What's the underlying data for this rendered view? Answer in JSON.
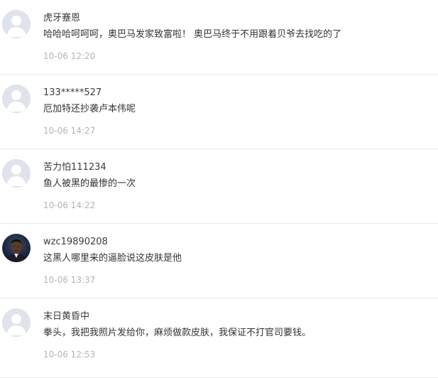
{
  "comments": [
    {
      "username": "虎牙蹇恩",
      "text": "哈哈哈呵呵呵，奥巴马发家致富啦！ 奥巴马终于不用跟着贝爷去找吃的了",
      "time": "10-06 12:20",
      "avatar": "default-avatar-icon"
    },
    {
      "username": "133*****527",
      "text": "厄加特还抄袭卢本伟呢",
      "time": "10-06 14:27",
      "avatar": "default-avatar-icon"
    },
    {
      "username": "苦力怕111234",
      "text": "鱼人被黑的最惨的一次",
      "time": "10-06 14:22",
      "avatar": "default-avatar-icon"
    },
    {
      "username": "wzc19890208",
      "text": "这黑人哪里来的逼脸说这皮肤是他",
      "time": "10-06 13:37",
      "avatar": "photo-avatar"
    },
    {
      "username": "末日黄昏中",
      "text": "拳头，我把我照片发给你，麻烦做款皮肤，我保证不打官司要钱。",
      "time": "10-06 12:53",
      "avatar": "default-avatar-icon"
    }
  ],
  "colors": {
    "avatar_bg": "#dfe3ec",
    "avatar_fg": "#ffffff",
    "username": "#3b3b3b",
    "text": "#333333",
    "time": "#b3b3b3",
    "divider": "#e8e8e8"
  }
}
